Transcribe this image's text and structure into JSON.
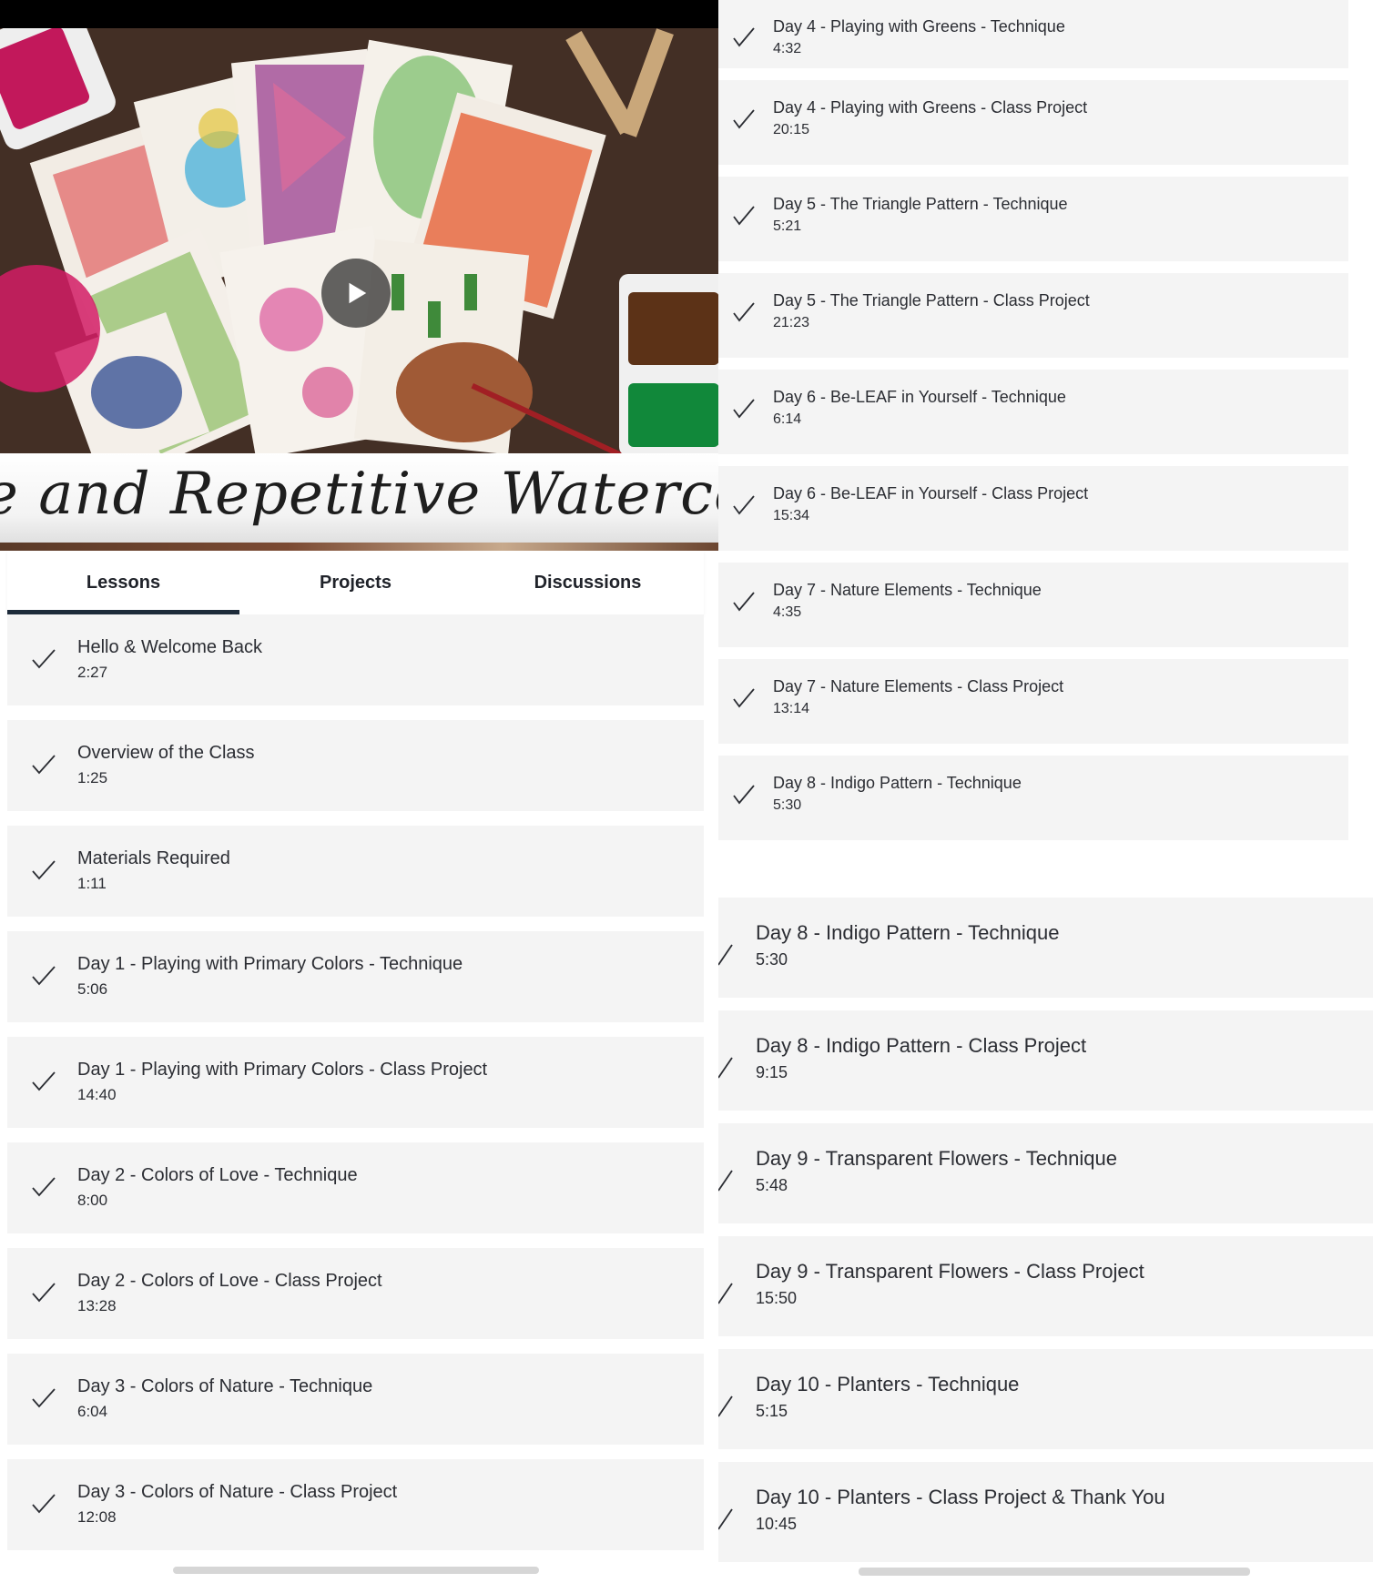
{
  "video": {
    "banner_text": "e and Repetitive Watercolor Patt"
  },
  "tabs": [
    {
      "label": "Lessons",
      "active": true
    },
    {
      "label": "Projects",
      "active": false
    },
    {
      "label": "Discussions",
      "active": false
    }
  ],
  "lessons_left": [
    {
      "title": "Hello & Welcome Back",
      "duration": "2:27"
    },
    {
      "title": "Overview of the Class",
      "duration": "1:25"
    },
    {
      "title": "Materials Required",
      "duration": "1:11"
    },
    {
      "title": "Day 1 - Playing with Primary Colors - Technique",
      "duration": "5:06"
    },
    {
      "title": "Day 1 - Playing with Primary Colors - Class Project",
      "duration": "14:40"
    },
    {
      "title": "Day 2 - Colors of Love - Technique",
      "duration": "8:00"
    },
    {
      "title": "Day 2 - Colors of Love - Class Project",
      "duration": "13:28"
    },
    {
      "title": "Day 3 - Colors of Nature - Technique",
      "duration": "6:04"
    },
    {
      "title": "Day 3  - Colors of Nature - Class Project",
      "duration": "12:08"
    }
  ],
  "lessons_right_top": [
    {
      "title": "Day 4 - Playing with Greens - Technique",
      "duration": "4:32"
    },
    {
      "title": "Day 4 - Playing with Greens - Class Project",
      "duration": "20:15"
    },
    {
      "title": "Day 5 - The Triangle Pattern  - Technique",
      "duration": "5:21"
    },
    {
      "title": "Day 5 - The Triangle Pattern - Class Project",
      "duration": "21:23"
    },
    {
      "title": "Day 6 - Be-LEAF in Yourself - Technique",
      "duration": "6:14"
    },
    {
      "title": "Day 6 - Be-LEAF in Yourself - Class Project",
      "duration": "15:34"
    },
    {
      "title": "Day 7 - Nature Elements - Technique",
      "duration": "4:35"
    },
    {
      "title": "Day 7 - Nature Elements - Class Project",
      "duration": "13:14"
    },
    {
      "title": "Day 8 - Indigo Pattern - Technique",
      "duration": "5:30"
    }
  ],
  "lessons_right_bottom": [
    {
      "title": "Day 8 - Indigo Pattern - Technique",
      "duration": "5:30"
    },
    {
      "title": "Day 8 - Indigo Pattern - Class Project",
      "duration": "9:15"
    },
    {
      "title": "Day 9 - Transparent Flowers - Technique",
      "duration": "5:48"
    },
    {
      "title": "Day 9 - Transparent Flowers - Class Project",
      "duration": "15:50"
    },
    {
      "title": "Day 10 - Planters  - Technique",
      "duration": "5:15"
    },
    {
      "title": "Day 10 - Planters - Class Project & Thank You",
      "duration": "10:45"
    }
  ],
  "icons": {
    "check": "check-icon",
    "play": "play-icon"
  },
  "colors": {
    "tab_underline": "#1d2b3a",
    "row_bg": "#f4f4f4",
    "text": "#2b2d33"
  }
}
